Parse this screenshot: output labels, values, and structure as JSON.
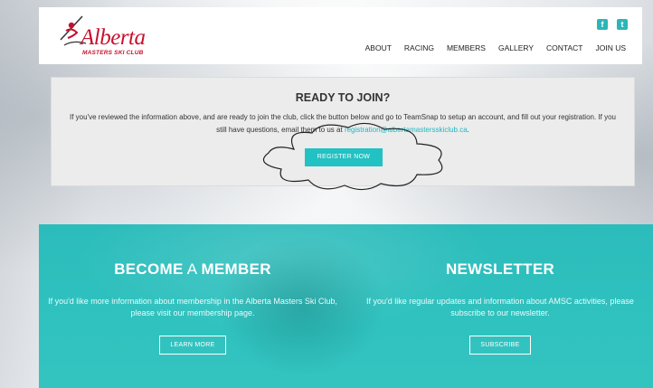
{
  "header": {
    "logo_text": "Alberta",
    "logo_sub": "MASTERS SKI CLUB",
    "social": [
      {
        "icon": "facebook-icon",
        "glyph": "f"
      },
      {
        "icon": "twitter-icon",
        "glyph": "t"
      }
    ],
    "nav": [
      "ABOUT",
      "RACING",
      "MEMBERS",
      "GALLERY",
      "CONTACT",
      "JOIN US"
    ]
  },
  "join": {
    "title": "READY TO JOIN?",
    "text_before": "If you've reviewed the information above, and are ready to join the club, click the button below and go to TeamSnap to setup an account, and fill out your registration. If you still have questions, email them to us at ",
    "email": "registration@albertamastersskiclub.ca",
    "text_after": ".",
    "button": "REGISTER NOW"
  },
  "member": {
    "title_bold1": "BECOME",
    "title_thin": " A ",
    "title_bold2": "MEMBER",
    "text": "If you'd like more information about membership in the Alberta Masters Ski Club, please visit our membership page.",
    "button": "LEARN MORE"
  },
  "newsletter": {
    "title": "NEWSLETTER",
    "text": "If you'd like regular updates and information about AMSC activities, please subscribe to our newsletter.",
    "button": "SUBSCRIBE"
  },
  "colors": {
    "accent": "#22c1c3",
    "brand": "#c8102e"
  }
}
